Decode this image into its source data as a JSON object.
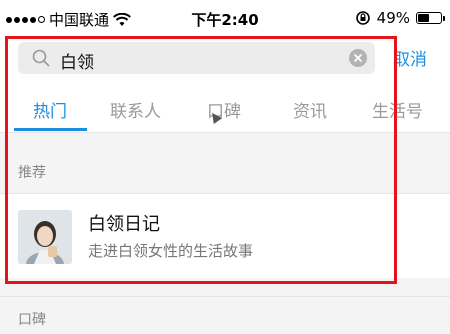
{
  "status_bar": {
    "carrier": "中国联通",
    "time": "下午2:40",
    "battery": "49%",
    "battery_level": 0.49
  },
  "search": {
    "value": "白领",
    "cancel_label": "取消"
  },
  "tabs": [
    {
      "label": "热门",
      "active": true
    },
    {
      "label": "联系人",
      "active": false
    },
    {
      "label": "口碑",
      "active": false
    },
    {
      "label": "资讯",
      "active": false
    },
    {
      "label": "生活号",
      "active": false
    }
  ],
  "sections": {
    "recommended": {
      "title": "推荐",
      "result": {
        "title": "白领日记",
        "description": "走进白领女性的生活故事"
      }
    },
    "koubei": {
      "title": "口碑"
    }
  },
  "colors": {
    "accent": "#1a8fe0",
    "highlight": "#e3141b"
  }
}
